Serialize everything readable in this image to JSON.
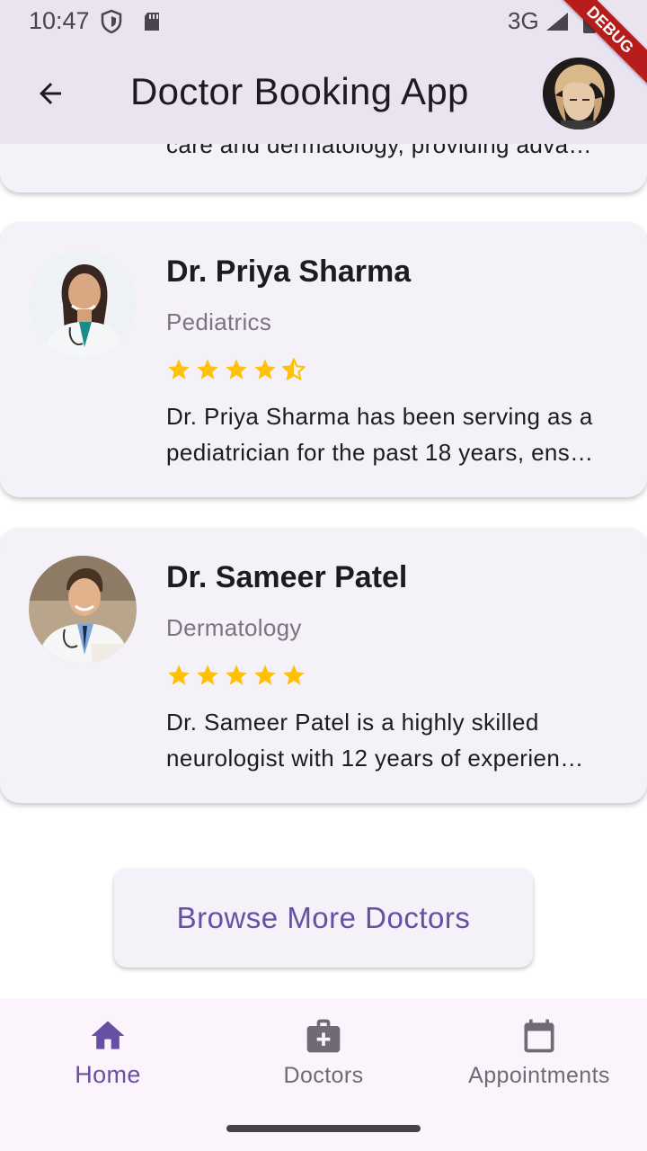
{
  "status_bar": {
    "time": "10:47",
    "network": "3G",
    "icons": [
      "shield-icon",
      "sd-card-icon",
      "signal-icon",
      "battery-icon"
    ]
  },
  "app_bar": {
    "title": "Doctor Booking App",
    "back_icon": "arrow-back-icon",
    "avatar": "profile-avatar"
  },
  "debug_banner": "DEBUG",
  "doctors": [
    {
      "description": "care and dermatology, providing adva…"
    },
    {
      "name": "Dr. Priya Sharma",
      "specialty": "Pediatrics",
      "rating": 4.5,
      "description_line1": "Dr. Priya Sharma has been serving as a",
      "description_line2": "pediatrician for the past 18 years, ens…"
    },
    {
      "name": "Dr. Sameer Patel",
      "specialty": "Dermatology",
      "rating": 5,
      "description_line1": "Dr. Sameer Patel is a highly skilled",
      "description_line2": "neurologist with 12 years of experien…"
    }
  ],
  "browse_button": "Browse More Doctors",
  "bottom_nav": [
    {
      "label": "Home",
      "icon": "home-icon",
      "active": true
    },
    {
      "label": "Doctors",
      "icon": "medical-bag-icon",
      "active": false
    },
    {
      "label": "Appointments",
      "icon": "calendar-icon",
      "active": false
    }
  ],
  "colors": {
    "primary": "#6750a4",
    "app_bar_bg": "#e9e4f0",
    "card_bg": "#f4f1f8",
    "star": "#ffc107",
    "debug": "#b71c1c"
  }
}
